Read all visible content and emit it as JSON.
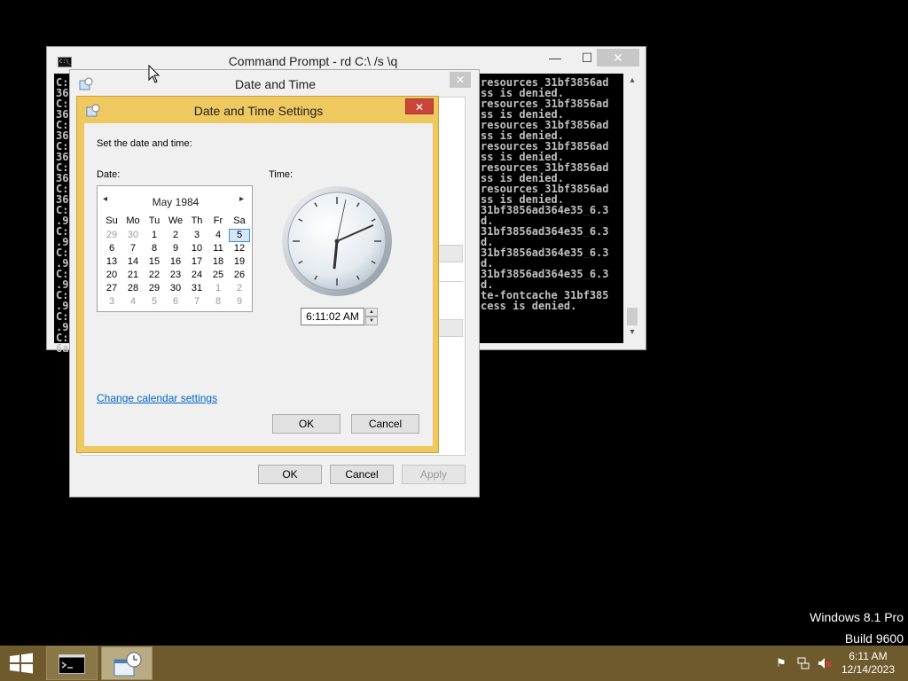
{
  "cmd": {
    "title": "Command Prompt - rd  C:\\ /s \\q",
    "left_lines": [
      "C:",
      "36",
      "C:",
      "36",
      "C:",
      "36",
      "C:",
      "36",
      "C:",
      "36",
      "C:",
      "36",
      "C:",
      ".9",
      "C:",
      ".9",
      "C:",
      ".9",
      "C:",
      ".9",
      "C:",
      ".9",
      "C:",
      ".9",
      "C:",
      "6a"
    ],
    "right_lines": [
      "resources_31bf3856ad",
      "ss is denied.",
      "resources_31bf3856ad",
      "ss is denied.",
      "resources_31bf3856ad",
      "ss is denied.",
      "resources_31bf3856ad",
      "ss is denied.",
      "resources_31bf3856ad",
      "ss is denied.",
      "resources_31bf3856ad",
      "ss is denied.",
      "31bf3856ad364e35_6.3",
      "d.",
      "31bf3856ad364e35_6.3",
      "d.",
      "31bf3856ad364e35_6.3",
      "d.",
      "31bf3856ad364e35_6.3",
      "d.",
      "te-fontcache_31bf385",
      "cess is denied."
    ],
    "caption_minimize": "—",
    "caption_maximize": "☐",
    "caption_close": "✕",
    "scroll_up": "▴",
    "scroll_down": "▾"
  },
  "date_time": {
    "title": "Date and Time",
    "close": "✕",
    "ok": "OK",
    "cancel": "Cancel",
    "apply": "Apply"
  },
  "settings": {
    "title": "Date and Time Settings",
    "close": "✕",
    "instruction": "Set the date and time:",
    "date_label": "Date:",
    "time_label": "Time:",
    "month": "May 1984",
    "prev": "◂",
    "next": "▸",
    "weekdays": [
      "Su",
      "Mo",
      "Tu",
      "We",
      "Th",
      "Fr",
      "Sa"
    ],
    "weeks": [
      [
        "29",
        "30",
        "1",
        "2",
        "3",
        "4",
        "5"
      ],
      [
        "6",
        "7",
        "8",
        "9",
        "10",
        "11",
        "12"
      ],
      [
        "13",
        "14",
        "15",
        "16",
        "17",
        "18",
        "19"
      ],
      [
        "20",
        "21",
        "22",
        "23",
        "24",
        "25",
        "26"
      ],
      [
        "27",
        "28",
        "29",
        "30",
        "31",
        "1",
        "2"
      ],
      [
        "3",
        "4",
        "5",
        "6",
        "7",
        "8",
        "9"
      ]
    ],
    "selected_day": "5",
    "time_value": "6:11:02 AM",
    "clock": {
      "hour": 6,
      "minute": 11,
      "second": 2
    },
    "calendar_link": "Change calendar settings",
    "ok": "OK",
    "cancel": "Cancel"
  },
  "desktop": {
    "os_name": "Windows 8.1 Pro",
    "build": "Build 9600"
  },
  "taskbar": {
    "time": "6:11 AM",
    "date": "12/14/2023",
    "colors": {
      "taskbar": "#6e5a2c",
      "accent": "#f0c860"
    }
  }
}
